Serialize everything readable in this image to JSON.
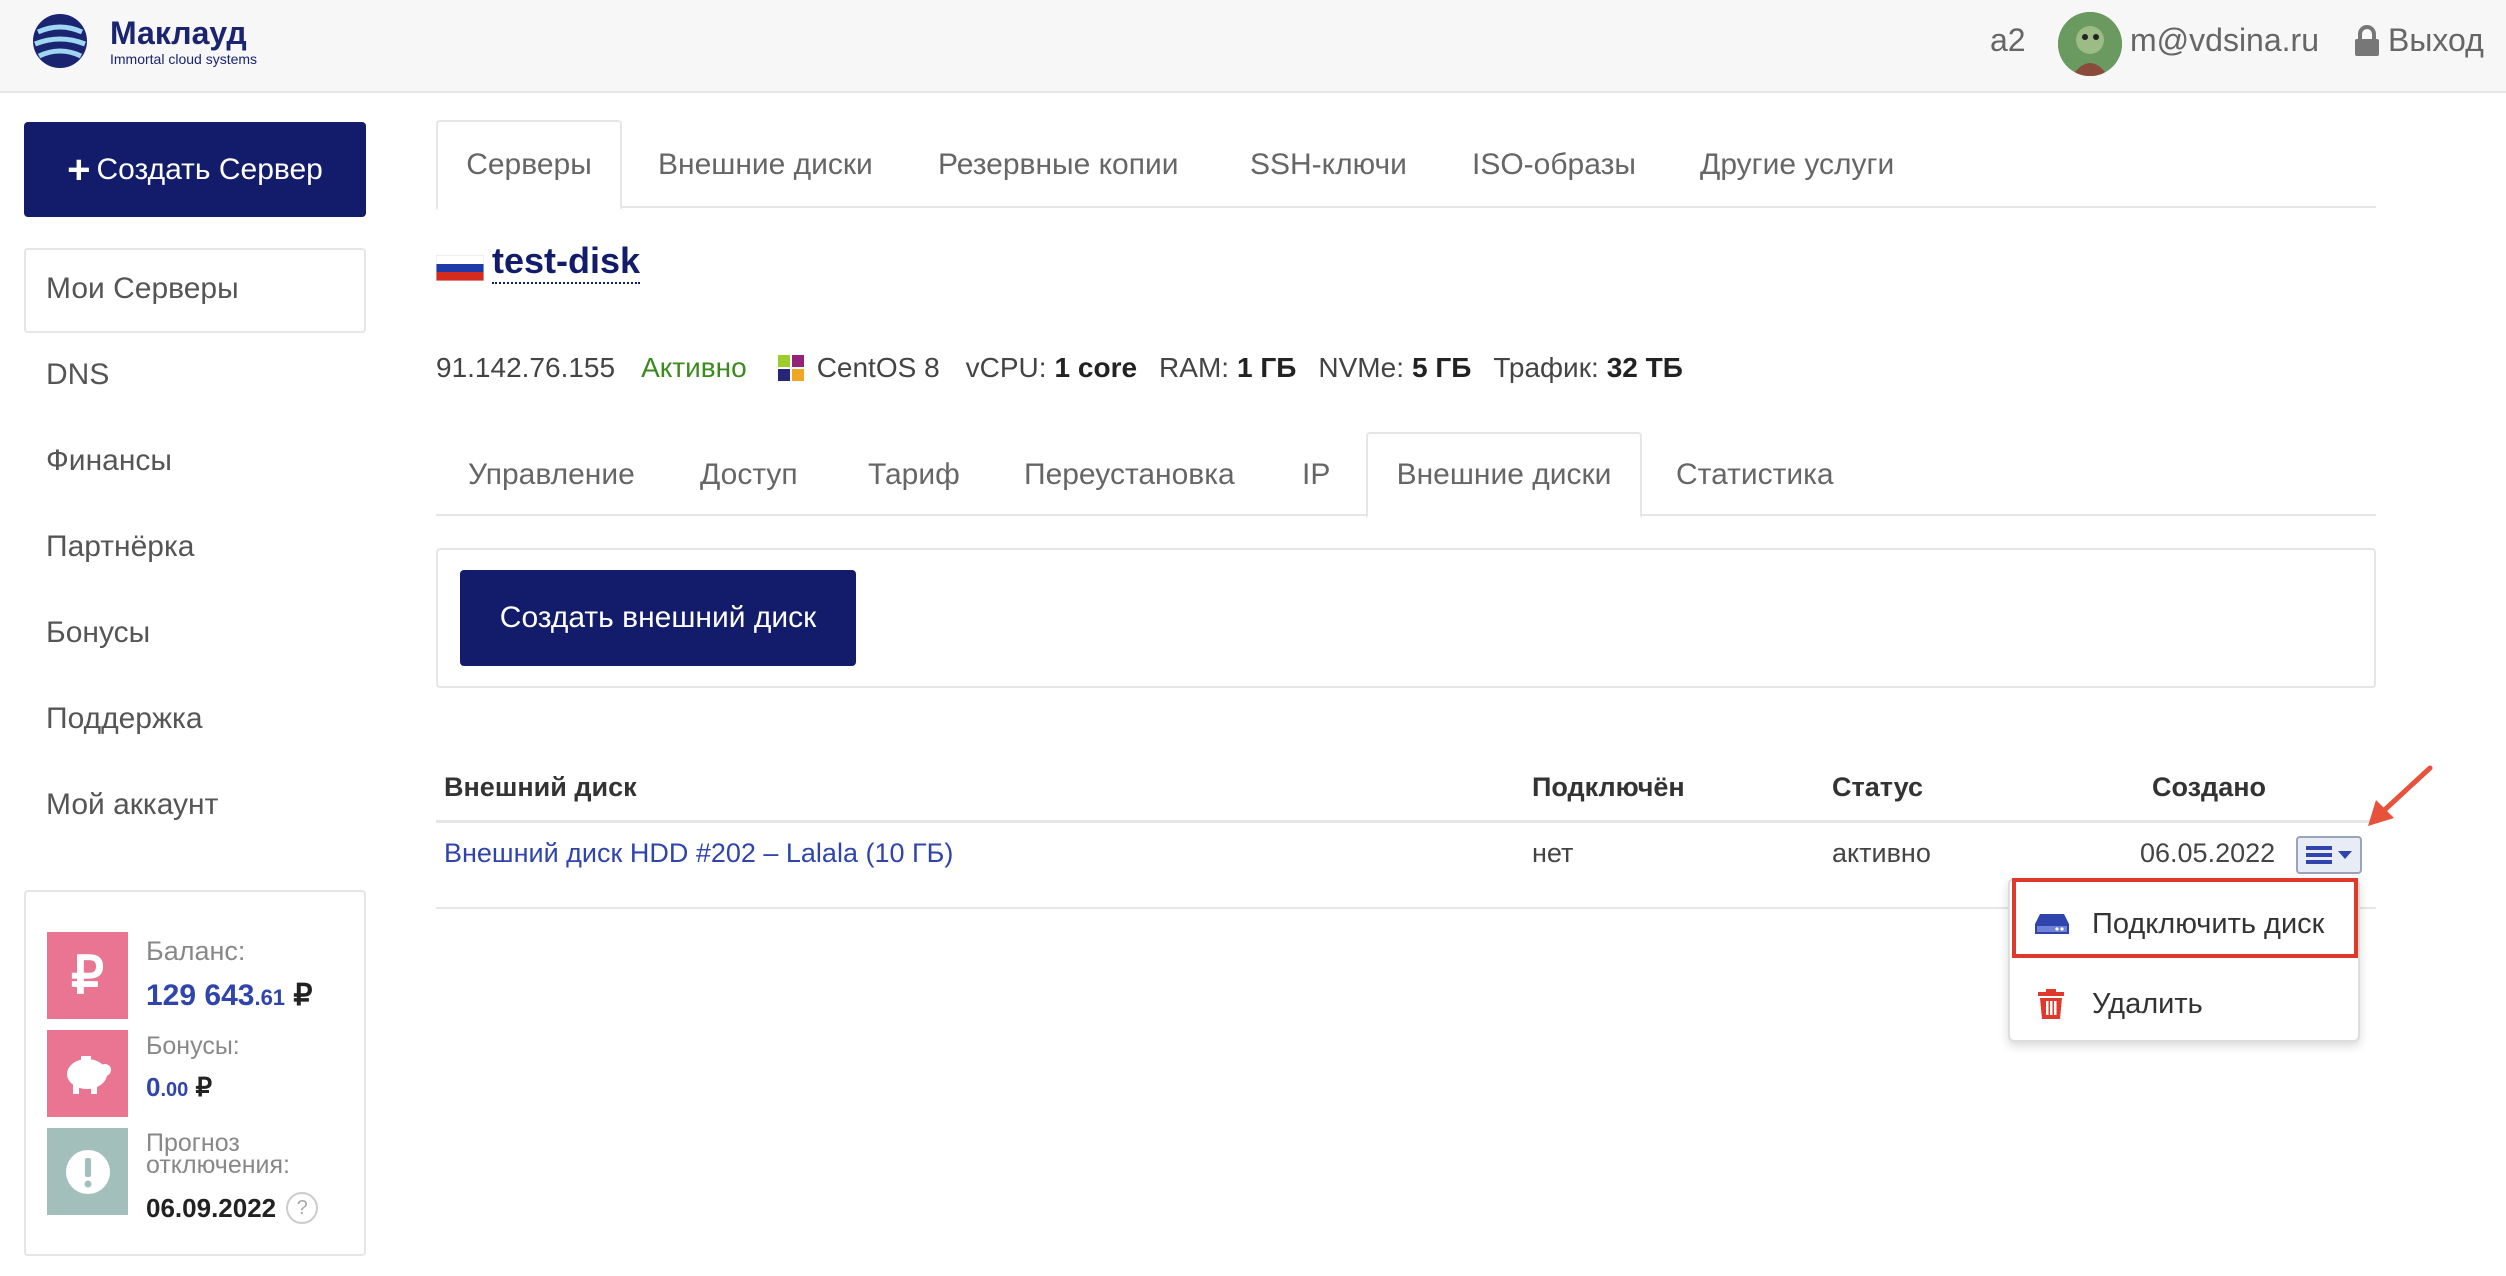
{
  "colors": {
    "brand": "#121c6b",
    "link": "#2f45ad",
    "active_green": "#3b8a1e",
    "highlight_red": "#e0392b",
    "balance_pink": "#ea7593",
    "forecast_gray": "#a3bfbc"
  },
  "header": {
    "logo_name": "Маклауд",
    "logo_sub": "Immortal cloud systems",
    "account": "a2",
    "email": "m@vdsina.ru",
    "logout": "Выход"
  },
  "sidebar": {
    "create_button": "Создать Сервер",
    "items": [
      "Мои Серверы",
      "DNS",
      "Финансы",
      "Партнёрка",
      "Бонусы",
      "Поддержка",
      "Мой аккаунт"
    ]
  },
  "balance": {
    "balance_label": "Баланс:",
    "balance_int": "129 643",
    "balance_frac": ".61",
    "bonus_label": "Бонусы:",
    "bonus_int": "0",
    "bonus_frac": ".00",
    "currency": "₽",
    "forecast_label_1": "Прогноз",
    "forecast_label_2": "отключения:",
    "forecast_date": "06.09.2022",
    "help": "?"
  },
  "main_tabs": [
    "Серверы",
    "Внешние диски",
    "Резервные копии",
    "SSH-ключи",
    "ISO-образы",
    "Другие услуги"
  ],
  "server": {
    "name": "test-disk",
    "ip": "91.142.76.155",
    "status": "Активно",
    "os": "CentOS 8",
    "vcpu_label": "vCPU:",
    "vcpu_value": "1 core",
    "ram_label": "RAM:",
    "ram_value": "1 ГБ",
    "nvme_label": "NVMe:",
    "nvme_value": "5 ГБ",
    "traffic_label": "Трафик:",
    "traffic_value": "32 ТБ"
  },
  "sub_tabs": [
    "Управление",
    "Доступ",
    "Тариф",
    "Переустановка",
    "IP",
    "Внешние диски",
    "Статистика"
  ],
  "create_disk_button": "Создать внешний диск",
  "table": {
    "headers": [
      "Внешний диск",
      "Подключён",
      "Статус",
      "Создано"
    ],
    "rows": [
      {
        "disk": "Внешний диск HDD #202 – Lalala (10 ГБ)",
        "connected": "нет",
        "status": "активно",
        "created": "06.05.2022"
      }
    ]
  },
  "dropdown": {
    "attach": "Подключить диск",
    "delete": "Удалить"
  }
}
